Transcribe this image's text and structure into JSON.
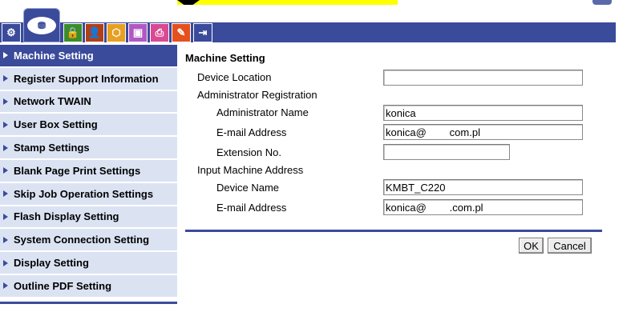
{
  "tabs": [
    {
      "name": "tab-administration",
      "glyph": "⚙"
    },
    {
      "name": "tab-maintenance",
      "glyph": "⛃"
    },
    {
      "name": "tab-security",
      "glyph": "🔒"
    },
    {
      "name": "tab-user-auth",
      "glyph": "👤"
    },
    {
      "name": "tab-network",
      "glyph": "⬡"
    },
    {
      "name": "tab-box",
      "glyph": "▣"
    },
    {
      "name": "tab-print",
      "glyph": "⎙"
    },
    {
      "name": "tab-store",
      "glyph": "✎"
    },
    {
      "name": "tab-system",
      "glyph": "⇥"
    }
  ],
  "menu": {
    "items": [
      {
        "label": "Machine Setting"
      },
      {
        "label": "Register Support Information"
      },
      {
        "label": "Network TWAIN"
      },
      {
        "label": "User Box Setting"
      },
      {
        "label": "Stamp Settings"
      },
      {
        "label": "Blank Page Print Settings"
      },
      {
        "label": "Skip Job Operation Settings"
      },
      {
        "label": "Flash Display Setting"
      },
      {
        "label": "System Connection Setting"
      },
      {
        "label": "Display Setting"
      },
      {
        "label": "Outline PDF Setting"
      }
    ]
  },
  "main": {
    "title": "Machine Setting",
    "device_location_label": "Device Location",
    "device_location_value": "",
    "admin_registration_label": "Administrator Registration",
    "admin_name_label": "Administrator Name",
    "admin_name_value": "konica",
    "admin_email_label": "E-mail Address",
    "admin_email_value": "konica@        com.pl",
    "extension_label": "Extension No.",
    "extension_value": "",
    "input_machine_address_label": "Input Machine Address",
    "device_name_label": "Device Name",
    "device_name_value": "KMBT_C220",
    "machine_email_label": "E-mail Address",
    "machine_email_value": "konica@        .com.pl"
  },
  "buttons": {
    "ok": "OK",
    "cancel": "Cancel"
  },
  "colors": {
    "accent": "#3b4b9b",
    "menu_bg": "#dbe3f3",
    "highlight": "#ffff00"
  }
}
